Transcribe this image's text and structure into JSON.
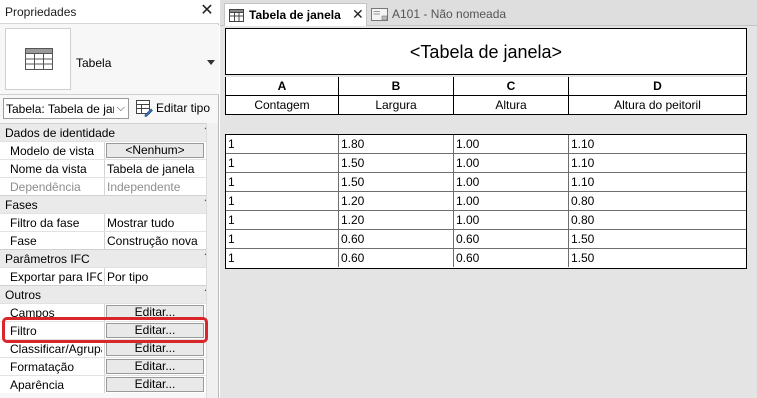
{
  "properties": {
    "title": "Propriedades",
    "close_glyph": "✕",
    "type_name": "Tabela",
    "instance_selector": "Tabela: Tabela de janela",
    "edit_type_label": "Editar tipo",
    "groups": {
      "identity": {
        "label": "Dados de identidade",
        "rows": [
          {
            "label": "Modelo de vista",
            "value": "<Nenhum>",
            "kind": "button"
          },
          {
            "label": "Nome da vista",
            "value": "Tabela de janela",
            "kind": "text"
          },
          {
            "label": "Dependência",
            "value": "Independente",
            "kind": "disabled"
          }
        ]
      },
      "phases": {
        "label": "Fases",
        "rows": [
          {
            "label": "Filtro da fase",
            "value": "Mostrar tudo",
            "kind": "text"
          },
          {
            "label": "Fase",
            "value": "Construção nova",
            "kind": "text"
          }
        ]
      },
      "ifc": {
        "label": "Parâmetros IFC",
        "rows": [
          {
            "label": "Exportar para IFC",
            "value": "Por tipo",
            "kind": "text"
          }
        ]
      },
      "others": {
        "label": "Outros",
        "rows": [
          {
            "label": "Campos",
            "value": "Editar...",
            "kind": "button"
          },
          {
            "label": "Filtro",
            "value": "Editar...",
            "kind": "button"
          },
          {
            "label": "Classificar/Agrupar",
            "value": "Editar...",
            "kind": "button"
          },
          {
            "label": "Formatação",
            "value": "Editar...",
            "kind": "button"
          },
          {
            "label": "Aparência",
            "value": "Editar...",
            "kind": "button"
          }
        ]
      }
    },
    "highlight_color": "#d9262b"
  },
  "tabs": [
    {
      "label": "Tabela de janela",
      "active": true,
      "close_glyph": "✕"
    },
    {
      "label": "A101 - Não nomeada",
      "active": false
    }
  ],
  "schedule": {
    "title": "<Tabela de janela>",
    "column_letters": [
      "A",
      "B",
      "C",
      "D"
    ],
    "column_names": [
      "Contagem",
      "Largura",
      "Altura",
      "Altura do peitoril"
    ],
    "rows": [
      [
        "1",
        "1.80",
        "1.00",
        "1.10"
      ],
      [
        "1",
        "1.50",
        "1.00",
        "1.10"
      ],
      [
        "1",
        "1.50",
        "1.00",
        "1.10"
      ],
      [
        "1",
        "1.20",
        "1.00",
        "0.80"
      ],
      [
        "1",
        "1.20",
        "1.00",
        "0.80"
      ],
      [
        "1",
        "0.60",
        "0.60",
        "1.50"
      ],
      [
        "1",
        "0.60",
        "0.60",
        "1.50"
      ]
    ]
  },
  "icons": {
    "panel_close": "close-icon",
    "type_preview": "schedule-table-icon",
    "edit_type": "edit-type-icon",
    "tab_schedule": "schedule-tab-icon",
    "tab_sheet": "sheet-tab-icon"
  }
}
